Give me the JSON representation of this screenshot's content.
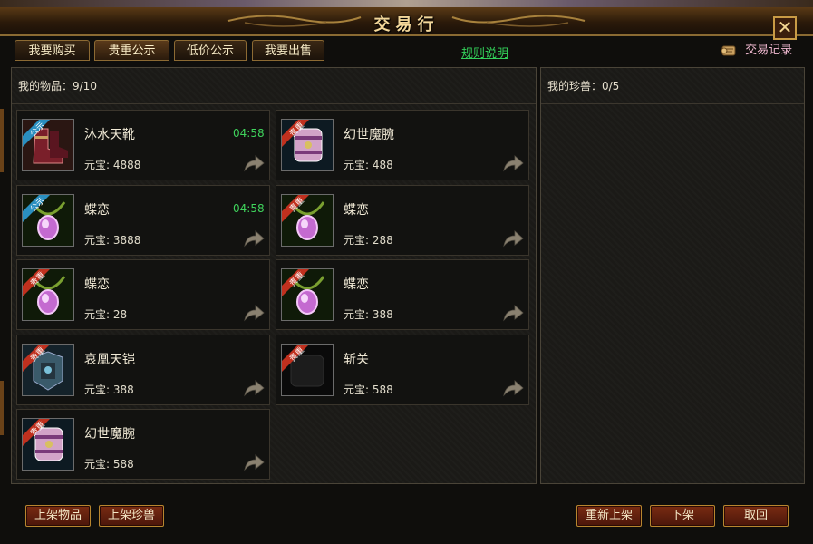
{
  "window": {
    "title": "交易行",
    "close_label": "✕"
  },
  "tabs": [
    {
      "label": "我要购买"
    },
    {
      "label": "贵重公示"
    },
    {
      "label": "低价公示"
    },
    {
      "label": "我要出售"
    }
  ],
  "rules_link": "规则说明",
  "trade_record": "交易记录",
  "left_panel": {
    "header": "我的物品：9/10",
    "items": [
      {
        "name": "沐水天靴",
        "price": "元宝: 4888",
        "timer": "04:58",
        "badge": "公示",
        "icon": "boots-icon"
      },
      {
        "name": "幻世魔腕",
        "price": "元宝: 488",
        "timer": "",
        "badge": "贵重",
        "icon": "bracer-icon"
      },
      {
        "name": "蝶恋",
        "price": "元宝: 3888",
        "timer": "04:58",
        "badge": "公示",
        "icon": "pendant-icon"
      },
      {
        "name": "蝶恋",
        "price": "元宝: 288",
        "timer": "",
        "badge": "贵重",
        "icon": "pendant-icon"
      },
      {
        "name": "蝶恋",
        "price": "元宝: 28",
        "timer": "",
        "badge": "贵重",
        "icon": "pendant-icon"
      },
      {
        "name": "蝶恋",
        "price": "元宝: 388",
        "timer": "",
        "badge": "贵重",
        "icon": "pendant-icon"
      },
      {
        "name": "哀凰天铠",
        "price": "元宝: 388",
        "timer": "",
        "badge": "贵重",
        "icon": "armor-icon"
      },
      {
        "name": "斩关",
        "price": "元宝: 588",
        "timer": "",
        "badge": "贵重",
        "icon": "dark-item-icon"
      },
      {
        "name": "幻世魔腕",
        "price": "元宝: 588",
        "timer": "",
        "badge": "贵重",
        "icon": "bracer-icon"
      }
    ]
  },
  "right_panel": {
    "header": "我的珍兽：0/5"
  },
  "buttons": {
    "list_item": "上架物品",
    "list_pet": "上架珍兽",
    "relist": "重新上架",
    "delist": "下架",
    "retrieve": "取回"
  },
  "colors": {
    "timer": "#3fd35c",
    "rules_link": "#33d15a",
    "badge_public": "#2a8fc0",
    "badge_valuable": "#c0301e",
    "title": "#f3d79a"
  }
}
